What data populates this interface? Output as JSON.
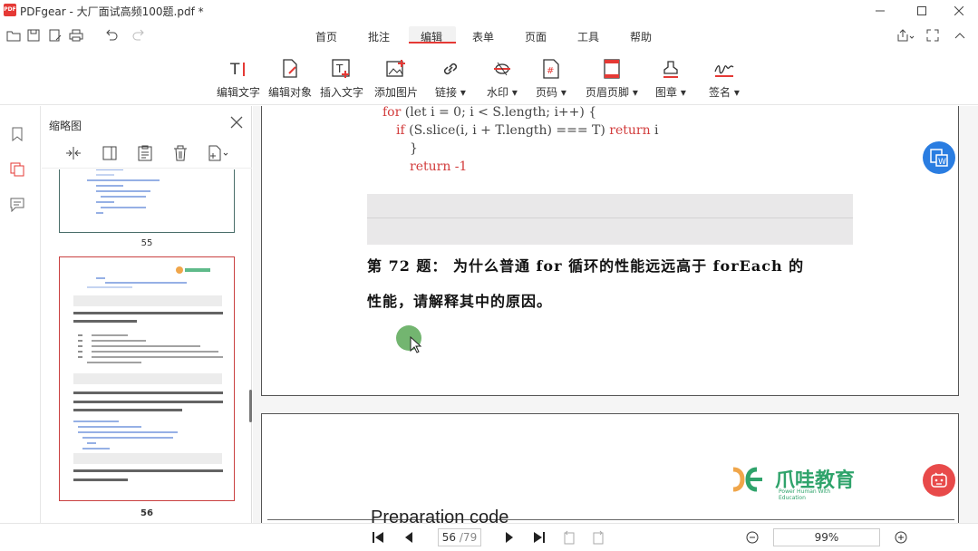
{
  "window": {
    "title": "PDFgear - 大厂面试高频100题.pdf *",
    "logo_text": "PDF"
  },
  "menu": {
    "tabs": [
      {
        "label": "首页"
      },
      {
        "label": "批注"
      },
      {
        "label": "编辑",
        "active": true
      },
      {
        "label": "表单"
      },
      {
        "label": "页面"
      },
      {
        "label": "工具"
      },
      {
        "label": "帮助"
      }
    ]
  },
  "toolbar": {
    "items": [
      {
        "label": "编辑文字",
        "icon": "edit-text-icon"
      },
      {
        "label": "编辑对象",
        "icon": "edit-object-icon"
      },
      {
        "label": "插入文字",
        "icon": "insert-text-icon"
      },
      {
        "label": "添加图片",
        "icon": "add-image-icon"
      },
      {
        "label": "链接",
        "icon": "link-icon",
        "dropdown": true
      },
      {
        "label": "水印",
        "icon": "watermark-icon",
        "dropdown": true
      },
      {
        "label": "页码",
        "icon": "page-number-icon",
        "dropdown": true
      },
      {
        "label": "页眉页脚",
        "icon": "header-footer-icon",
        "dropdown": true
      },
      {
        "label": "图章",
        "icon": "stamp-icon",
        "dropdown": true
      },
      {
        "label": "签名",
        "icon": "signature-icon",
        "dropdown": true
      }
    ]
  },
  "thumbnails": {
    "title": "缩略图",
    "pages": [
      {
        "number": "55"
      },
      {
        "number": "56",
        "selected": true
      }
    ]
  },
  "document": {
    "code_lines": [
      {
        "kw": "for",
        "rest": " (let i = 0; i < S.length; i++) {"
      },
      {
        "kw": "if",
        "rest": " (S.slice(i, i + T.length) === T) ",
        "kw2": "return",
        "tail": " i"
      },
      {
        "rest": "}"
      },
      {
        "kw": "return",
        "rest": " -1"
      }
    ],
    "question_line1": "第 72 题： 为什么普通 for 循环的性能远远高于 forEach 的",
    "question_line2": "性能，请解释其中的原因。",
    "brand_name": "爪哇教育",
    "brand_sub": "Power Human With Education",
    "next_heading": "Preparation code"
  },
  "status": {
    "current_page": "56",
    "total_pages": "/79",
    "zoom": "99%"
  },
  "colors": {
    "accent": "#e53935",
    "float_blue": "#2a7de1",
    "float_red": "#e84a4a",
    "brand_green": "#2fa36b"
  }
}
